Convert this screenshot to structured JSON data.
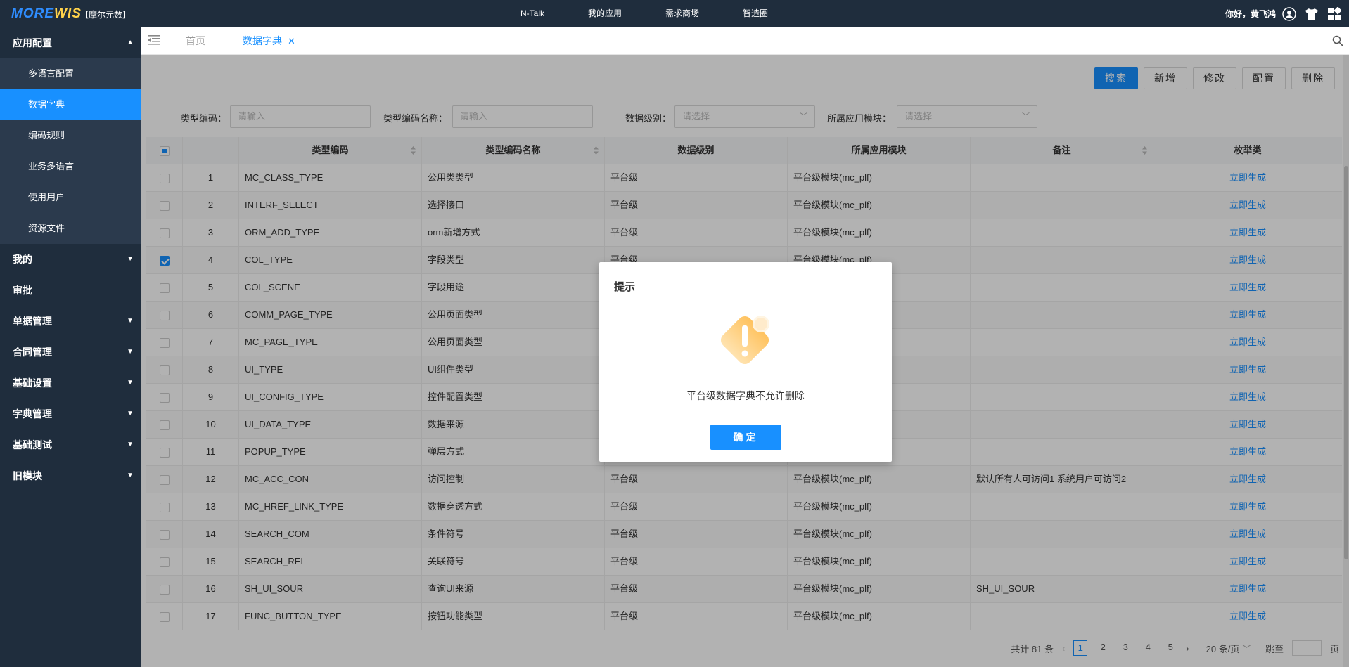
{
  "header": {
    "logo_part1": "MORE",
    "logo_part2": "WIS",
    "brand": "【摩尔元数】",
    "nav": [
      "N-Talk",
      "我的应用",
      "需求商场",
      "智造圈"
    ],
    "greeting": "你好，黄飞鸿",
    "icons": [
      "user-circle-icon",
      "shirt-icon",
      "apps-grid-icon"
    ]
  },
  "sidebar": {
    "groups": [
      {
        "label": "应用配置",
        "expanded": true,
        "items": [
          {
            "label": "多语言配置",
            "active": false
          },
          {
            "label": "数据字典",
            "active": true
          },
          {
            "label": "编码规则",
            "active": false
          },
          {
            "label": "业务多语言",
            "active": false
          },
          {
            "label": "使用用户",
            "active": false
          },
          {
            "label": "资源文件",
            "active": false
          }
        ]
      },
      {
        "label": "我的",
        "expanded": false,
        "has_arrow": true
      },
      {
        "label": "审批",
        "expanded": false,
        "has_arrow": false
      },
      {
        "label": "单据管理",
        "expanded": false,
        "has_arrow": true
      },
      {
        "label": "合同管理",
        "expanded": false,
        "has_arrow": true
      },
      {
        "label": "基础设置",
        "expanded": false,
        "has_arrow": true
      },
      {
        "label": "字典管理",
        "expanded": false,
        "has_arrow": true
      },
      {
        "label": "基础测试",
        "expanded": false,
        "has_arrow": true
      },
      {
        "label": "旧模块",
        "expanded": false,
        "has_arrow": true
      }
    ]
  },
  "tabs": {
    "home": "首页",
    "active": "数据字典",
    "close": "✕"
  },
  "toolbar": {
    "search": "搜索",
    "add": "新增",
    "edit": "修改",
    "config": "配置",
    "delete": "删除"
  },
  "filters": {
    "type_code_label": "类型编码：",
    "type_code_placeholder": "请输入",
    "type_name_label": "类型编码名称：",
    "type_name_placeholder": "请输入",
    "level_label": "数据级别：",
    "level_placeholder": "请选择",
    "module_label": "所属应用模块：",
    "module_placeholder": "请选择"
  },
  "table": {
    "headers": [
      "",
      "",
      "类型编码",
      "类型编码名称",
      "数据级别",
      "所属应用模块",
      "备注",
      "枚举类"
    ],
    "rows": [
      {
        "no": "1",
        "code": "MC_CLASS_TYPE",
        "name": "公用类类型",
        "level": "平台级",
        "module": "平台级模块(mc_plf)",
        "remark": "",
        "action": "立即生成",
        "checked": false
      },
      {
        "no": "2",
        "code": "INTERF_SELECT",
        "name": "选择接口",
        "level": "平台级",
        "module": "平台级模块(mc_plf)",
        "remark": "",
        "action": "立即生成",
        "checked": false
      },
      {
        "no": "3",
        "code": "ORM_ADD_TYPE",
        "name": "orm新增方式",
        "level": "平台级",
        "module": "平台级模块(mc_plf)",
        "remark": "",
        "action": "立即生成",
        "checked": false
      },
      {
        "no": "4",
        "code": "COL_TYPE",
        "name": "字段类型",
        "level": "平台级",
        "module": "平台级模块(mc_plf)",
        "remark": "",
        "action": "立即生成",
        "checked": true
      },
      {
        "no": "5",
        "code": "COL_SCENE",
        "name": "字段用途",
        "level": "",
        "module": "",
        "remark": "",
        "action": "立即生成",
        "checked": false
      },
      {
        "no": "6",
        "code": "COMM_PAGE_TYPE",
        "name": "公用页面类型",
        "level": "",
        "module": "",
        "remark": "",
        "action": "立即生成",
        "checked": false
      },
      {
        "no": "7",
        "code": "MC_PAGE_TYPE",
        "name": "公用页面类型",
        "level": "",
        "module": "",
        "remark": "",
        "action": "立即生成",
        "checked": false
      },
      {
        "no": "8",
        "code": "UI_TYPE",
        "name": "UI组件类型",
        "level": "",
        "module": "",
        "remark": "",
        "action": "立即生成",
        "checked": false
      },
      {
        "no": "9",
        "code": "UI_CONFIG_TYPE",
        "name": "控件配置类型",
        "level": "",
        "module": "",
        "remark": "",
        "action": "立即生成",
        "checked": false
      },
      {
        "no": "10",
        "code": "UI_DATA_TYPE",
        "name": "数据来源",
        "level": "",
        "module": "",
        "remark": "",
        "action": "立即生成",
        "checked": false
      },
      {
        "no": "11",
        "code": "POPUP_TYPE",
        "name": "弹层方式",
        "level": "",
        "module": "",
        "remark": "",
        "action": "立即生成",
        "checked": false
      },
      {
        "no": "12",
        "code": "MC_ACC_CON",
        "name": "访问控制",
        "level": "平台级",
        "module": "平台级模块(mc_plf)",
        "remark": "默认所有人可访问1 系统用户可访问2",
        "action": "立即生成",
        "checked": false
      },
      {
        "no": "13",
        "code": "MC_HREF_LINK_TYPE",
        "name": "数据穿透方式",
        "level": "平台级",
        "module": "平台级模块(mc_plf)",
        "remark": "",
        "action": "立即生成",
        "checked": false
      },
      {
        "no": "14",
        "code": "SEARCH_COM",
        "name": "条件符号",
        "level": "平台级",
        "module": "平台级模块(mc_plf)",
        "remark": "",
        "action": "立即生成",
        "checked": false
      },
      {
        "no": "15",
        "code": "SEARCH_REL",
        "name": "关联符号",
        "level": "平台级",
        "module": "平台级模块(mc_plf)",
        "remark": "",
        "action": "立即生成",
        "checked": false
      },
      {
        "no": "16",
        "code": "SH_UI_SOUR",
        "name": "查询UI来源",
        "level": "平台级",
        "module": "平台级模块(mc_plf)",
        "remark": "SH_UI_SOUR",
        "action": "立即生成",
        "checked": false
      },
      {
        "no": "17",
        "code": "FUNC_BUTTON_TYPE",
        "name": "按钮功能类型",
        "level": "平台级",
        "module": "平台级模块(mc_plf)",
        "remark": "",
        "action": "立即生成",
        "checked": false
      }
    ]
  },
  "pager": {
    "total": "共计 81 条",
    "prev": "‹",
    "pages": [
      "1",
      "2",
      "3",
      "4",
      "5"
    ],
    "current": "1",
    "next": "›",
    "page_size": "20 条/页",
    "jump_label": "跳至",
    "page_suffix": "页"
  },
  "dialog": {
    "title": "提示",
    "message": "平台级数据字典不允许删除",
    "confirm": "确定",
    "icon": "warning-icon"
  },
  "colors": {
    "primary": "#1890ff",
    "sidebar_bg": "#1f2d3d",
    "warning": "#ffb84a"
  }
}
